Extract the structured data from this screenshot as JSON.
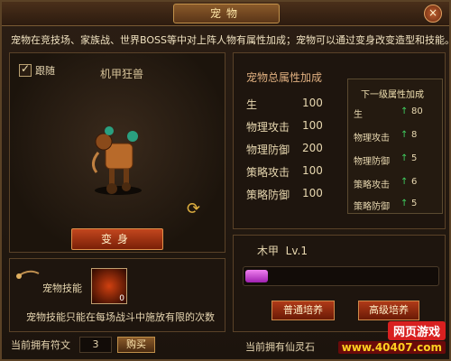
{
  "window": {
    "title": "宠物",
    "close": "×"
  },
  "description": "宠物在竞技场、家族战、世界BOSS等中对上阵人物有属性加成；宠物可以通过变身改变造型和技能。",
  "pet": {
    "follow_label": "跟随",
    "follow_checked": true,
    "name": "机甲狂兽",
    "transform_label": "变身"
  },
  "total_stats": {
    "title": "宠物总属性加成",
    "items": [
      {
        "label": "生",
        "value": "100"
      },
      {
        "label": "物理攻击",
        "value": "100"
      },
      {
        "label": "物理防御",
        "value": "200"
      },
      {
        "label": "策略攻击",
        "value": "100"
      },
      {
        "label": "策略防御",
        "value": "100"
      }
    ]
  },
  "next_stats": {
    "title": "下一级属性加成",
    "items": [
      {
        "label": "生",
        "value": "80"
      },
      {
        "label": "物理攻击",
        "value": "8"
      },
      {
        "label": "物理防御",
        "value": "5"
      },
      {
        "label": "策略攻击",
        "value": "6"
      },
      {
        "label": "策略防御",
        "value": "5"
      }
    ]
  },
  "training": {
    "element": "木甲",
    "level": "Lv.1",
    "progress": 0.12,
    "normal_btn": "普通培养",
    "advanced_btn": "高级培养"
  },
  "skill": {
    "title": "宠物技能",
    "count": "0",
    "desc": "宠物技能只能在每场战斗中施放有限的次数"
  },
  "footer": {
    "runes_label": "当前拥有符文",
    "runes_value": "3",
    "buy_label": "购买",
    "stones_label": "当前拥有仙灵石"
  },
  "watermark": {
    "top": "网页游戏",
    "bottom": "www.40407.com"
  }
}
